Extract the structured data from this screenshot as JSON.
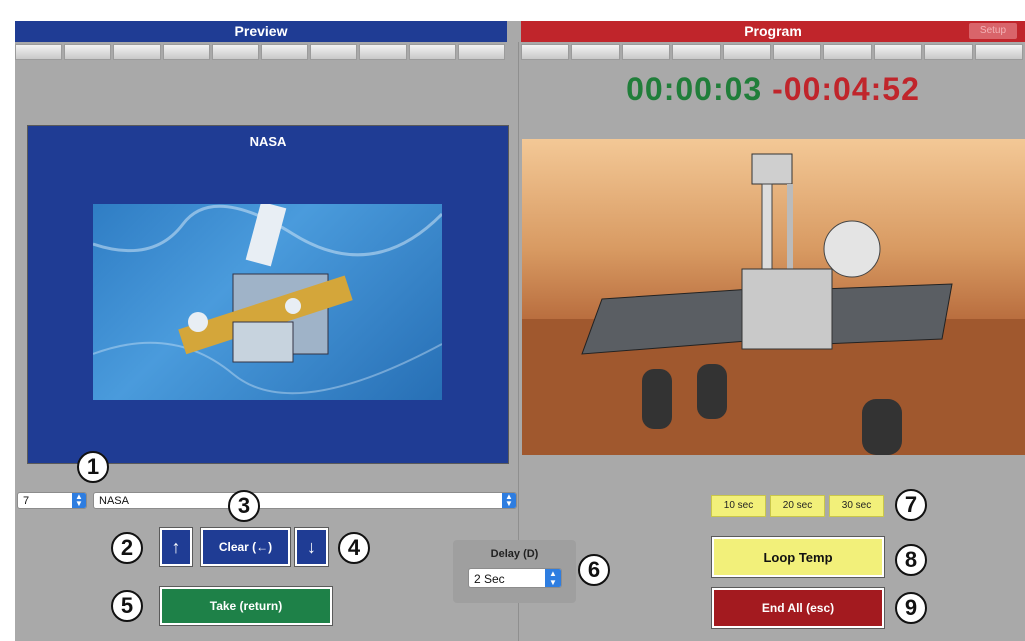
{
  "preview": {
    "header": "Preview",
    "caption": "NASA"
  },
  "program": {
    "header": "Program",
    "setup_label": "Setup"
  },
  "timer": {
    "elapsed": "00:00:03",
    "remaining": "-00:04:52"
  },
  "source_select": {
    "value": "7"
  },
  "name_select": {
    "value": "NASA"
  },
  "controls": {
    "up_label": "↑",
    "clear_label": "Clear (←)",
    "down_label": "↓",
    "take_label": "Take (return)"
  },
  "delay": {
    "label": "Delay (D)",
    "value": "2 Sec"
  },
  "quick_timers": [
    "10 sec",
    "20 sec",
    "30 sec"
  ],
  "loop_label": "Loop Temp",
  "end_label": "End All (esc)",
  "callouts": [
    "1",
    "2",
    "3",
    "4",
    "5",
    "6",
    "7",
    "8",
    "9"
  ],
  "colors": {
    "preview_blue": "#1f3c94",
    "program_red": "#c0252b",
    "take_green": "#1e8148",
    "loop_yellow": "#f2f07a",
    "end_red": "#a31a1f",
    "elapsed_green": "#207e3a"
  }
}
